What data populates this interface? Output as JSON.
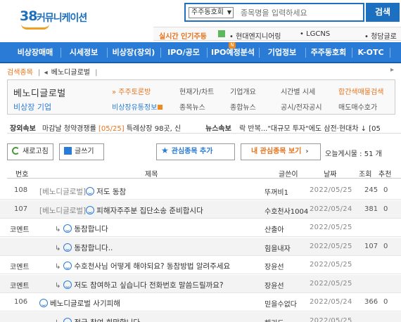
{
  "logo": {
    "number": "38",
    "text": "커뮤니케이션"
  },
  "search": {
    "category": "주주동호회",
    "placeholder": "종목명을 입력하세요",
    "button": "검색"
  },
  "realtime": {
    "label": "실시간 인기주등",
    "items": [
      "현대엔지니어링",
      "LGCNS",
      "청담글로"
    ]
  },
  "nav": [
    "비상장매매",
    "시세정보",
    "비상장(장외)",
    "IPO/공모",
    "IPO예정분석",
    "기업정보",
    "주주동호회",
    "K-OTC"
  ],
  "nav_badge": "N",
  "breadcrumb": {
    "label": "검색종목",
    "sep": "|",
    "value": "베노디글로벌",
    "bar": "|"
  },
  "stock": {
    "name": "베노디글로벌",
    "type": "비상장 기업",
    "links_top": [
      "주주토론방",
      "현재가/차트",
      "기업개요",
      "시간별 시세",
      "합간색매물검색"
    ],
    "links_bottom": [
      "비상장유통정보",
      "종목뉴스",
      "종합뉴스",
      "공시/전자공시",
      "매도매수호가"
    ]
  },
  "ticker": {
    "label1": "장외속보",
    "text1a": "마감날 청약경쟁률",
    "text1b": "[05/25]",
    "text1c": "특례상장 98곳, 신",
    "label2": "뉴스속보",
    "text2": "락 반복...\"대규모 투자\"에도 삼전·현대차 ↓",
    "text2b": "[05"
  },
  "toolbar": {
    "refresh": "새로고침",
    "write": "글쓰기",
    "add_interest": "관심종목 추가",
    "my_interest": "내 관심종목 보기",
    "views": "오늘게시물 : 51 개"
  },
  "table": {
    "headers": [
      "번호",
      "제목",
      "글쓴이",
      "날짜",
      "조회",
      "추천"
    ],
    "rows": [
      {
        "no": "108",
        "prefix": "[베노디글로벌]",
        "title": "저도 동참",
        "author": "뚜꺼비1",
        "date": "2022/05/25",
        "views": "245",
        "rec": "0",
        "kind": "post",
        "shade": false
      },
      {
        "no": "107",
        "prefix": "[베노디글로벌]",
        "title": "피해자주주분 집단소송 준비합시다",
        "author": "수호천사1004",
        "date": "2022/05/24",
        "views": "381",
        "rec": "0",
        "kind": "post",
        "shade": true
      },
      {
        "no": "코멘트",
        "prefix": "",
        "title": "동참합니다",
        "author": "산출아",
        "date": "2022/05/25",
        "views": "",
        "rec": "",
        "kind": "comment",
        "shade": false
      },
      {
        "no": "",
        "prefix": "",
        "title": "동참합니다..",
        "author": "힘을내자",
        "date": "2022/05/25",
        "views": "107",
        "rec": "0",
        "kind": "comment",
        "shade": true
      },
      {
        "no": "코멘트",
        "prefix": "",
        "title": "수호천사님 어떻게 해야되요? 동참방법 알려주세요",
        "author": "장윤선",
        "date": "2022/05/25",
        "views": "",
        "rec": "",
        "kind": "comment",
        "shade": false
      },
      {
        "no": "코멘트",
        "prefix": "",
        "title": "저도 참여하고 싶습니다 전화번호 말씀드릴까요?",
        "author": "장윤선",
        "date": "2022/05/25",
        "views": "",
        "rec": "",
        "kind": "comment",
        "shade": true
      },
      {
        "no": "106",
        "prefix": "",
        "title": "베노디글로벌 사기피해",
        "author": "믿을수없다",
        "date": "2022/05/24",
        "views": "366",
        "rec": "0",
        "kind": "post",
        "shade": false
      },
      {
        "no": "",
        "prefix": "",
        "title": "적극 참여 희망합니다",
        "author": "해리드",
        "date": "2022/05/25",
        "views": "",
        "rec": "",
        "kind": "comment",
        "shade": true
      }
    ]
  },
  "colors": {
    "brand": "#2a7bd6",
    "accent": "#e8731c",
    "date": "#888888"
  }
}
